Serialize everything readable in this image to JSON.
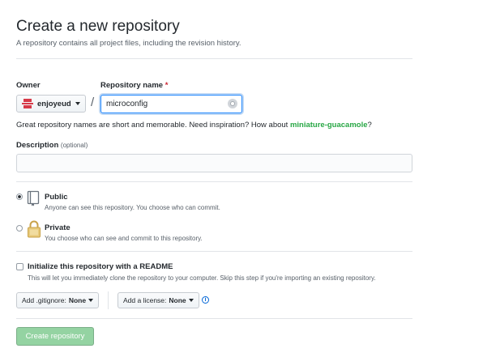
{
  "header": {
    "title": "Create a new repository",
    "subtitle": "A repository contains all project files, including the revision history."
  },
  "owner": {
    "label": "Owner",
    "value": "enjoyeud"
  },
  "separator": "/",
  "repo_name": {
    "label": "Repository name",
    "required_mark": "*",
    "value": "microconfig"
  },
  "hint": {
    "text": "Great repository names are short and memorable. Need inspiration? How about",
    "suggestion": "miniature-guacamole",
    "end": "?"
  },
  "description": {
    "label": "Description",
    "optional": "(optional)",
    "value": ""
  },
  "visibility": {
    "public": {
      "title": "Public",
      "desc": "Anyone can see this repository. You choose who can commit.",
      "selected": true
    },
    "private": {
      "title": "Private",
      "desc": "You choose who can see and commit to this repository.",
      "selected": false
    }
  },
  "readme": {
    "label": "Initialize this repository with a README",
    "desc": "This will let you immediately clone the repository to your computer. Skip this step if you're importing an existing repository.",
    "checked": false
  },
  "gitignore": {
    "label": "Add .gitignore:",
    "value": "None"
  },
  "license": {
    "label": "Add a license:",
    "value": "None"
  },
  "icons": {
    "owner_avatar": "avatar-icon",
    "name_check": "availability-icon",
    "public": "repo-book-icon",
    "private": "lock-icon",
    "info": "info-icon"
  },
  "colors": {
    "suggestion": "#28a745",
    "create_button": "#94d3a2",
    "focus_border": "#2188ff",
    "required": "#cb2431"
  },
  "create_button": {
    "label": "Create repository"
  }
}
